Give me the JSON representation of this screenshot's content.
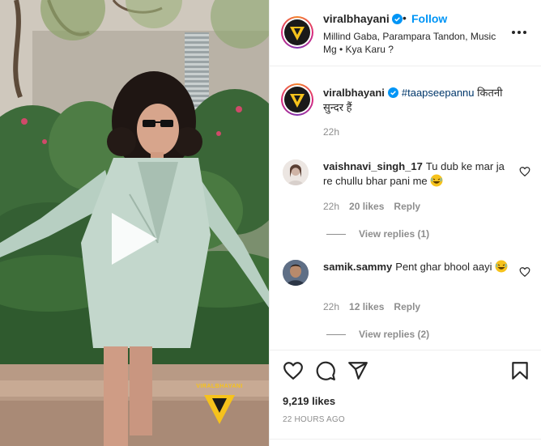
{
  "post": {
    "username": "viralbhayani",
    "follow_label": "Follow",
    "separator": "•",
    "location_music": "Millind Gaba, Parampara Tandon, Music Mg • Kya Karu ?",
    "watermark": "VIRALBHAYANI",
    "icons": {
      "verified": "verified-badge-icon",
      "more": "more-options-icon",
      "play": "play-icon"
    }
  },
  "caption": {
    "username": "viralbhayani",
    "hashtag": "#taapseepannu",
    "text": " कितनी सुन्दर हैं",
    "time": "22h"
  },
  "comments": [
    {
      "username": "vaishnavi_singh_17",
      "text": "Tu dub ke mar ja re chullu bhar pani me",
      "emoji": "laughing-emoji",
      "time": "22h",
      "likes": "20 likes",
      "reply_label": "Reply",
      "view_replies": "View replies (1)"
    },
    {
      "username": "samik.sammy",
      "text": "Pent ghar bhool aayi",
      "emoji": "laughing-emoji",
      "time": "22h",
      "likes": "12 likes",
      "reply_label": "Reply",
      "view_replies": "View replies (2)"
    }
  ],
  "actions": {
    "icons": [
      "like-icon",
      "comment-icon",
      "share-icon",
      "save-icon"
    ],
    "likes_count": "9,219 likes",
    "posted_ago": "22 HOURS AGO"
  },
  "colors": {
    "accent_blue": "#0095f6",
    "hashtag": "#00376b",
    "muted": "#8e8e8e",
    "brand_yellow": "#f6c21c"
  }
}
